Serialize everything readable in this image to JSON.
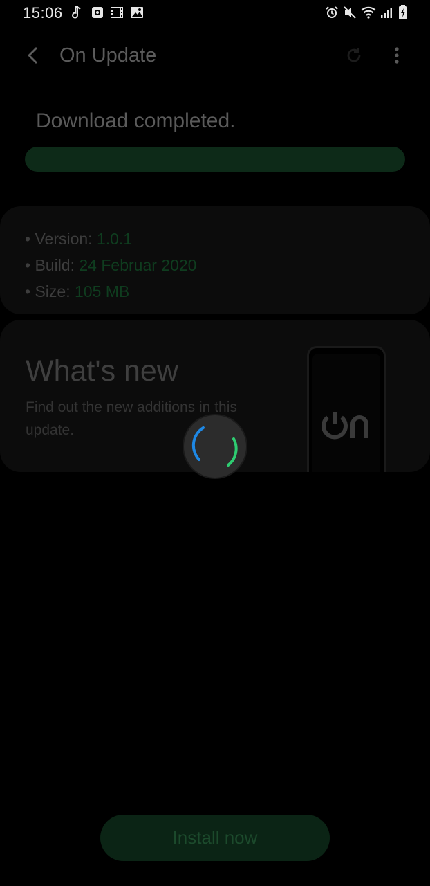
{
  "status_bar": {
    "time": "15:06",
    "left_icons": [
      "music-note-icon",
      "screen-recorder-icon",
      "film-icon",
      "image-icon"
    ],
    "right_icons": [
      "alarm-icon",
      "mute-icon",
      "wifi-icon",
      "signal-icon",
      "battery-charging-icon"
    ]
  },
  "app_bar": {
    "title": "On Update"
  },
  "download": {
    "status_text": "Download completed.",
    "progress_percent": 100
  },
  "info": {
    "version_label": "Version:",
    "version_value": "1.0.1",
    "build_label": "Build:",
    "build_value": "24 Februar 2020",
    "size_label": "Size:",
    "size_value": "105 MB",
    "bullet": "•"
  },
  "whats_new": {
    "title": "What's new",
    "description": "Find out the new additions in this update.",
    "logo_text": "On"
  },
  "install": {
    "label": "Install now"
  },
  "colors": {
    "accent_green": "#1db954",
    "spinner_blue": "#1e88e5",
    "spinner_green": "#2ecc71",
    "background": "#000000"
  }
}
